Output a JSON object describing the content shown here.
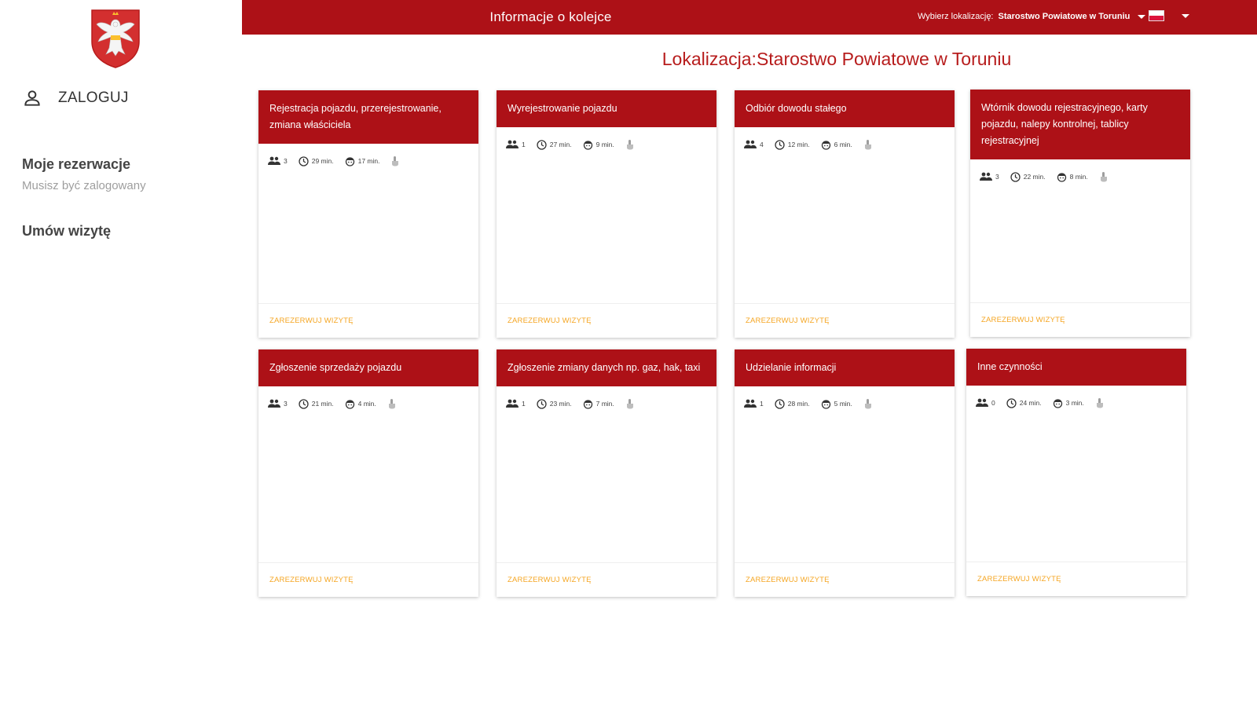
{
  "topbar": {
    "title": "Informacje o kolejce",
    "location_label": "Wybierz lokalizację:",
    "location_value": "Starostwo Powiatowe w Toruniu",
    "flag_colors": [
      "#ffffff",
      "#dc143c"
    ]
  },
  "sidebar": {
    "login_label": "ZALOGUJ",
    "reservations_title": "Moje rezerwacje",
    "reservations_sub": "Musisz być zalogowany",
    "book_title": "Umów wizytę"
  },
  "heading": "Lokalizacja:Starostwo Powiatowe w Toruniu",
  "colors": {
    "primary": "#ad1117",
    "accent": "#f5a623"
  },
  "cards": [
    {
      "title": "Rejestracja pojazdu, przerejestrowanie, zmiana właściciela",
      "people": "3",
      "wait": "29 min.",
      "service": "17 min.",
      "action": "ZAREZERWUJ WIZYTĘ"
    },
    {
      "title": "Wyrejestrowanie pojazdu",
      "people": "1",
      "wait": "27 min.",
      "service": "9 min.",
      "action": "ZAREZERWUJ WIZYTĘ"
    },
    {
      "title": "Odbiór dowodu stałego",
      "people": "4",
      "wait": "12 min.",
      "service": "6 min.",
      "action": "ZAREZERWUJ WIZYTĘ"
    },
    {
      "title": "Wtórnik dowodu rejestracyjnego, karty pojazdu, nalepy kontrolnej, tablicy rejestracyjnej",
      "people": "3",
      "wait": "22 min.",
      "service": "8 min.",
      "action": "ZAREZERWUJ WIZYTĘ"
    },
    {
      "title": "Zgłoszenie sprzedaży pojazdu",
      "people": "3",
      "wait": "21 min.",
      "service": "4 min.",
      "action": "ZAREZERWUJ WIZYTĘ"
    },
    {
      "title": "Zgłoszenie zmiany danych np. gaz, hak, taxi",
      "people": "1",
      "wait": "23 min.",
      "service": "7 min.",
      "action": "ZAREZERWUJ WIZYTĘ"
    },
    {
      "title": "Udzielanie informacji",
      "people": "1",
      "wait": "28 min.",
      "service": "5 min.",
      "action": "ZAREZERWUJ WIZYTĘ"
    },
    {
      "title": "Inne czynności",
      "people": "0",
      "wait": "24 min.",
      "service": "3 min.",
      "action": "ZAREZERWUJ WIZYTĘ"
    }
  ]
}
